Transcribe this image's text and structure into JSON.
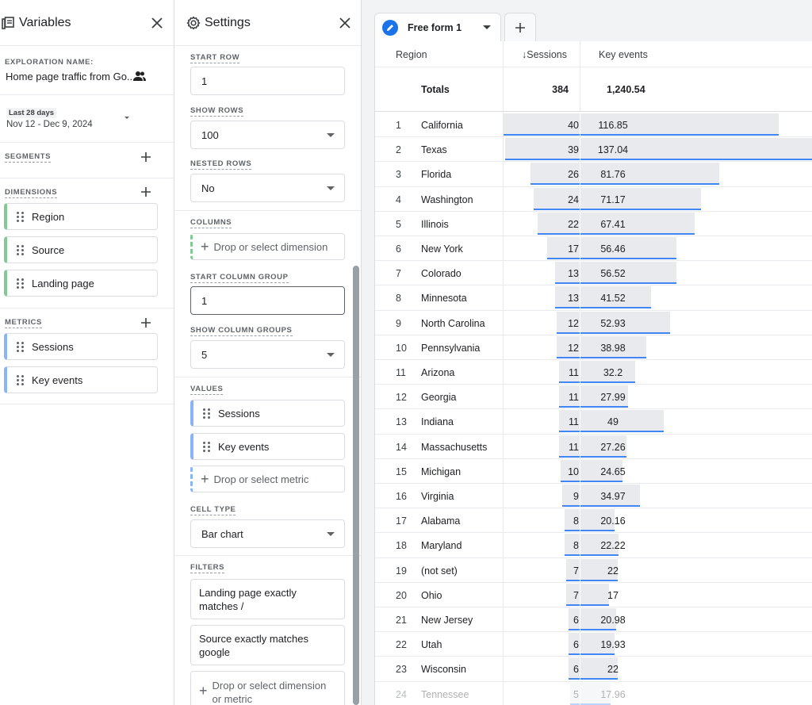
{
  "variables": {
    "title": "Variables",
    "exploration_label": "EXPLORATION NAME:",
    "exploration_name": "Home page traffic from Go...",
    "date_chip": "Last 28 days",
    "date_range": "Nov 12 - Dec 9, 2024",
    "segments_label": "SEGMENTS",
    "dimensions_label": "DIMENSIONS",
    "dimensions": [
      "Region",
      "Source",
      "Landing page"
    ],
    "metrics_label": "METRICS",
    "metrics": [
      "Sessions",
      "Key events"
    ]
  },
  "settings": {
    "title": "Settings",
    "start_row_label": "START ROW",
    "start_row": "1",
    "show_rows_label": "SHOW ROWS",
    "show_rows": "100",
    "nested_rows_label": "NESTED ROWS",
    "nested_rows": "No",
    "columns_label": "COLUMNS",
    "columns_drop": "Drop or select dimension",
    "start_col_group_label": "START COLUMN GROUP",
    "start_col_group": "1",
    "show_col_groups_label": "SHOW COLUMN GROUPS",
    "show_col_groups": "5",
    "values_label": "VALUES",
    "values": [
      "Sessions",
      "Key events"
    ],
    "values_drop": "Drop or select metric",
    "cell_type_label": "CELL TYPE",
    "cell_type": "Bar chart",
    "filters_label": "FILTERS",
    "filters": [
      "Landing page exactly matches /",
      "Source exactly matches google"
    ],
    "filters_drop": "Drop or select dimension or metric"
  },
  "canvas": {
    "tab_name": "Free form 1",
    "columns": {
      "region": "Region",
      "sessions": "↓Sessions",
      "key_events": "Key events"
    },
    "totals": {
      "label": "Totals",
      "sessions": "384",
      "key_events": "1,240.54"
    },
    "rows": [
      {
        "n": "1",
        "region": "California",
        "sessions": 40,
        "key_events": 116.85,
        "key_events_text": "116.85"
      },
      {
        "n": "2",
        "region": "Texas",
        "sessions": 39,
        "key_events": 137.04,
        "key_events_text": "137.04"
      },
      {
        "n": "3",
        "region": "Florida",
        "sessions": 26,
        "key_events": 81.76,
        "key_events_text": "81.76"
      },
      {
        "n": "4",
        "region": "Washington",
        "sessions": 24,
        "key_events": 71.17,
        "key_events_text": "71.17"
      },
      {
        "n": "5",
        "region": "Illinois",
        "sessions": 22,
        "key_events": 67.41,
        "key_events_text": "67.41"
      },
      {
        "n": "6",
        "region": "New York",
        "sessions": 17,
        "key_events": 56.46,
        "key_events_text": "56.46"
      },
      {
        "n": "7",
        "region": "Colorado",
        "sessions": 13,
        "key_events": 56.52,
        "key_events_text": "56.52"
      },
      {
        "n": "8",
        "region": "Minnesota",
        "sessions": 13,
        "key_events": 41.52,
        "key_events_text": "41.52"
      },
      {
        "n": "9",
        "region": "North Carolina",
        "sessions": 12,
        "key_events": 52.93,
        "key_events_text": "52.93"
      },
      {
        "n": "10",
        "region": "Pennsylvania",
        "sessions": 12,
        "key_events": 38.98,
        "key_events_text": "38.98"
      },
      {
        "n": "11",
        "region": "Arizona",
        "sessions": 11,
        "key_events": 32.2,
        "key_events_text": "32.2"
      },
      {
        "n": "12",
        "region": "Georgia",
        "sessions": 11,
        "key_events": 27.99,
        "key_events_text": "27.99"
      },
      {
        "n": "13",
        "region": "Indiana",
        "sessions": 11,
        "key_events": 49,
        "key_events_text": "49"
      },
      {
        "n": "14",
        "region": "Massachusetts",
        "sessions": 11,
        "key_events": 27.26,
        "key_events_text": "27.26"
      },
      {
        "n": "15",
        "region": "Michigan",
        "sessions": 10,
        "key_events": 24.65,
        "key_events_text": "24.65"
      },
      {
        "n": "16",
        "region": "Virginia",
        "sessions": 9,
        "key_events": 34.97,
        "key_events_text": "34.97"
      },
      {
        "n": "17",
        "region": "Alabama",
        "sessions": 8,
        "key_events": 20.16,
        "key_events_text": "20.16"
      },
      {
        "n": "18",
        "region": "Maryland",
        "sessions": 8,
        "key_events": 22.22,
        "key_events_text": "22.22"
      },
      {
        "n": "19",
        "region": "(not set)",
        "sessions": 7,
        "key_events": 22,
        "key_events_text": "22"
      },
      {
        "n": "20",
        "region": "Ohio",
        "sessions": 7,
        "key_events": 17,
        "key_events_text": "17"
      },
      {
        "n": "21",
        "region": "New Jersey",
        "sessions": 6,
        "key_events": 20.98,
        "key_events_text": "20.98"
      },
      {
        "n": "22",
        "region": "Utah",
        "sessions": 6,
        "key_events": 19.93,
        "key_events_text": "19.93"
      },
      {
        "n": "23",
        "region": "Wisconsin",
        "sessions": 6,
        "key_events": 22,
        "key_events_text": "22"
      },
      {
        "n": "24",
        "region": "Tennessee",
        "sessions": 5,
        "key_events": 17.96,
        "key_events_text": "17.96"
      }
    ]
  },
  "colors": {
    "accent": "#1a73e8",
    "bar_line": "#4285f4",
    "bar_fill": "#e8eaed",
    "dim_green": "#81c995",
    "metric_blue": "#8ab4f8"
  }
}
